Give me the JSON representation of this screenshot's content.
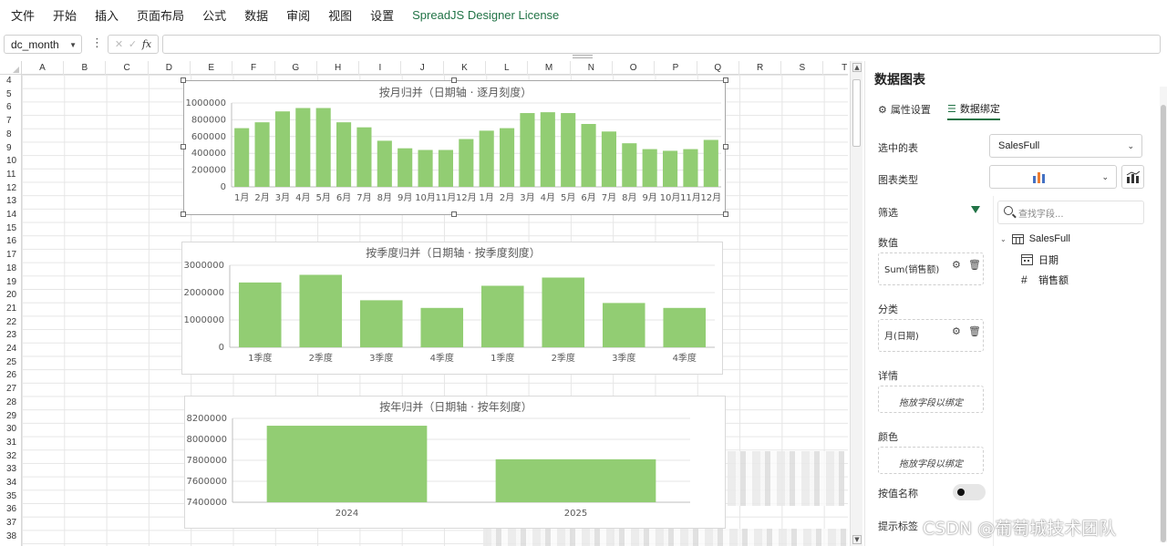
{
  "menu": {
    "items": [
      "文件",
      "开始",
      "插入",
      "页面布局",
      "公式",
      "数据",
      "审阅",
      "视图",
      "设置"
    ],
    "license": "SpreadJS Designer License"
  },
  "formula_bar": {
    "name_box": "dc_month",
    "value": ""
  },
  "sheet": {
    "columns": [
      "A",
      "B",
      "C",
      "D",
      "E",
      "F",
      "G",
      "H",
      "I",
      "J",
      "K",
      "L",
      "M",
      "N",
      "O",
      "P",
      "Q",
      "R",
      "S",
      "T"
    ],
    "rows": [
      "4",
      "5",
      "6",
      "7",
      "8",
      "9",
      "10",
      "11",
      "12",
      "13",
      "14",
      "15",
      "16",
      "17",
      "18",
      "19",
      "20",
      "21",
      "22",
      "23",
      "24",
      "25",
      "26",
      "27",
      "28",
      "29",
      "30",
      "31",
      "32",
      "33",
      "34",
      "35",
      "36",
      "37",
      "38"
    ]
  },
  "chart_data": [
    {
      "type": "bar",
      "title": "按月归并（日期轴 · 逐月刻度）",
      "categories": [
        "1月",
        "2月",
        "3月",
        "4月",
        "5月",
        "6月",
        "7月",
        "8月",
        "9月",
        "10月",
        "11月",
        "12月",
        "1月",
        "2月",
        "3月",
        "4月",
        "5月",
        "6月",
        "7月",
        "8月",
        "9月",
        "10月",
        "11月",
        "12月"
      ],
      "values": [
        700000,
        770000,
        900000,
        940000,
        940000,
        770000,
        710000,
        550000,
        460000,
        440000,
        440000,
        570000,
        670000,
        700000,
        880000,
        890000,
        880000,
        750000,
        660000,
        520000,
        450000,
        430000,
        450000,
        560000
      ],
      "ylim": [
        0,
        1000000
      ],
      "yticks": [
        "1000000",
        "800000",
        "600000",
        "400000",
        "200000",
        "0"
      ],
      "color": "#92cd73",
      "grid": true
    },
    {
      "type": "bar",
      "title": "按季度归并（日期轴 · 按季度刻度）",
      "categories": [
        "1季度",
        "2季度",
        "3季度",
        "4季度",
        "1季度",
        "2季度",
        "3季度",
        "4季度"
      ],
      "values": [
        2370000,
        2650000,
        1720000,
        1440000,
        2250000,
        2550000,
        1620000,
        1440000
      ],
      "ylim": [
        0,
        3000000
      ],
      "yticks": [
        "3000000",
        "2000000",
        "1000000",
        "0"
      ],
      "color": "#92cd73",
      "grid": true
    },
    {
      "type": "bar",
      "title": "按年归并（日期轴 · 按年刻度）",
      "categories": [
        "2024",
        "2025"
      ],
      "values": [
        8130000,
        7810000
      ],
      "ylim": [
        7400000,
        8200000
      ],
      "yticks": [
        "8200000",
        "8000000",
        "7800000",
        "7600000",
        "7400000"
      ],
      "color": "#92cd73",
      "grid": true
    }
  ],
  "panel": {
    "title": "数据图表",
    "tabs": [
      "属性设置",
      "数据绑定"
    ],
    "active_tab": "数据绑定",
    "table_label": "选中的表",
    "table_value": "SalesFull",
    "chart_type_label": "图表类型",
    "filter_label": "筛选",
    "values_label": "数值",
    "values_field": "Sum(销售额)",
    "category_label": "分类",
    "category_field": "月(日期)",
    "details_label": "详情",
    "details_hint": "拖放字段以绑定",
    "color_label": "颜色",
    "color_hint": "拖放字段以绑定",
    "by_value_label": "按值名称",
    "tooltip_label": "提示标签",
    "search_placeholder": "查找字段...",
    "tree_root": "SalesFull",
    "tree_fields": [
      "日期",
      "销售额"
    ]
  },
  "watermark": "CSDN @葡萄城技术团队"
}
